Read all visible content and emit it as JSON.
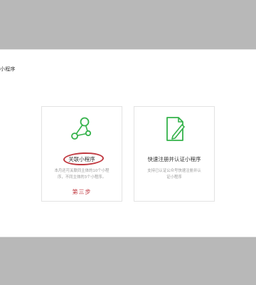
{
  "panel": {
    "title": "小程序"
  },
  "cards": [
    {
      "title": "关联小程序",
      "description": "本月还可关联同主体的10个小程序，不同主体的3个小程序。",
      "icon": "share-nodes-icon",
      "annotation": "第三步"
    },
    {
      "title": "快速注册并认证小程序",
      "description": "支持已认证公众号快速注册并认证小程序",
      "icon": "document-edit-icon"
    }
  ],
  "colors": {
    "brand_green": "#34b24a",
    "annotation_red": "#c03940",
    "gray_bar": "#b8b8b8"
  }
}
